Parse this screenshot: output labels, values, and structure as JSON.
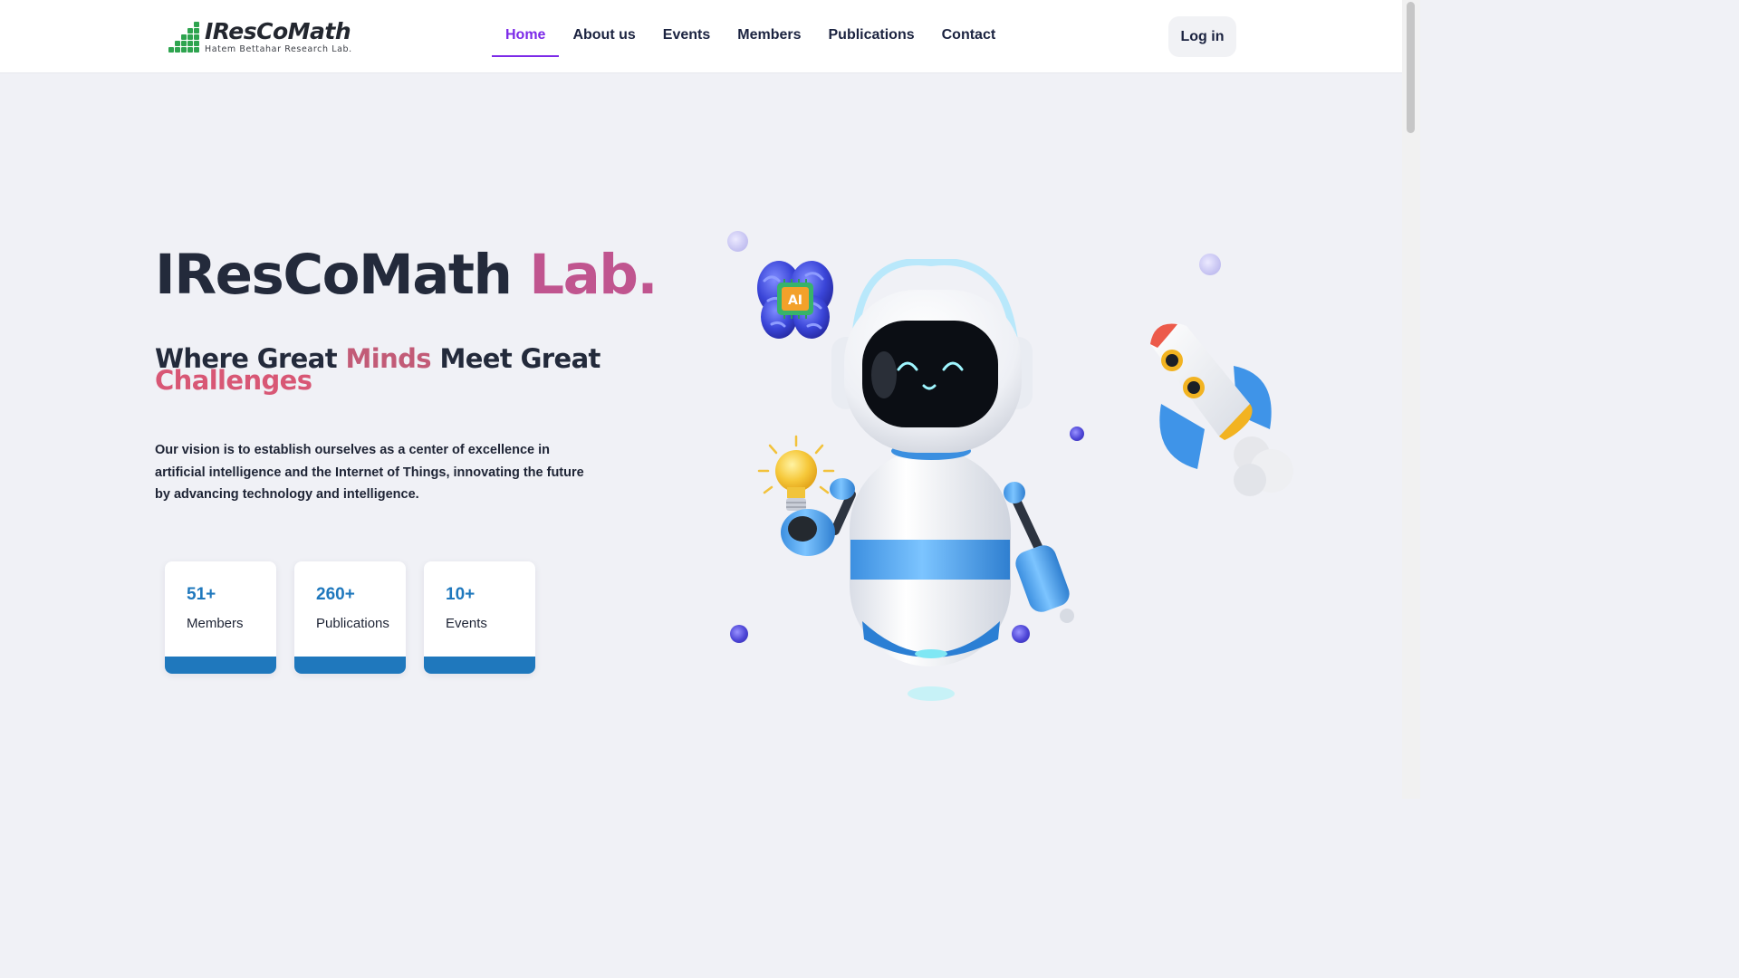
{
  "brand": {
    "name": "IResCoMath",
    "subtitle": "Hatem Bettahar Research Lab."
  },
  "nav": {
    "items": [
      {
        "label": "Home",
        "active": true
      },
      {
        "label": "About us",
        "active": false
      },
      {
        "label": "Events",
        "active": false
      },
      {
        "label": "Members",
        "active": false
      },
      {
        "label": "Publications",
        "active": false
      },
      {
        "label": "Contact",
        "active": false
      }
    ],
    "login_label": "Log in"
  },
  "hero": {
    "title_main": "IResCoMath",
    "title_accent": "Lab.",
    "tagline": {
      "part1": "Where Great",
      "minds": "Minds",
      "part2": "Meet Great",
      "challenges": "Challenges"
    },
    "vision": "Our vision is to establish ourselves as a center of excellence in artificial intelligence and the Internet of Things, innovating the future by advancing technology and intelligence."
  },
  "stats": [
    {
      "value": "51+",
      "label": "Members"
    },
    {
      "value": "260+",
      "label": "Publications"
    },
    {
      "value": "10+",
      "label": "Events"
    }
  ],
  "illustration": {
    "robot_icon": "robot-mascot-icon",
    "brain_icon": "ai-brain-chip-icon",
    "brain_chip_text": "AI",
    "bulb_icon": "lightbulb-icon",
    "rocket_icon": "rocket-icon"
  },
  "colors": {
    "accent_purple": "#7c2ae8",
    "accent_pink": "#c0558f",
    "stat_blue": "#1f78bd",
    "logo_green": "#2ea44f",
    "background": "#f0f1f6"
  }
}
